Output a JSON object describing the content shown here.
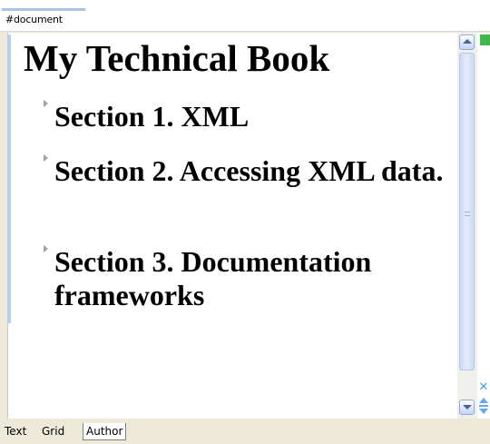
{
  "breadcrumb": {
    "path": "#document"
  },
  "document": {
    "title": "My Technical Book",
    "sections": [
      {
        "title": "Section 1. XML"
      },
      {
        "title": "Section 2. Accessing XML data."
      },
      {
        "title": "Section 3. Documentation frameworks"
      }
    ]
  },
  "tabs": [
    {
      "label": "Text",
      "active": false
    },
    {
      "label": "Grid",
      "active": false
    },
    {
      "label": "Author",
      "active": true
    }
  ],
  "colors": {
    "block_marker": "#b6cff0",
    "status_ok": "#3fb74c",
    "nav_icons": "#63a8e8"
  },
  "icons": [
    "close-icon",
    "navigate-arrows-icon",
    "scroll-up-icon",
    "scroll-down-icon"
  ]
}
